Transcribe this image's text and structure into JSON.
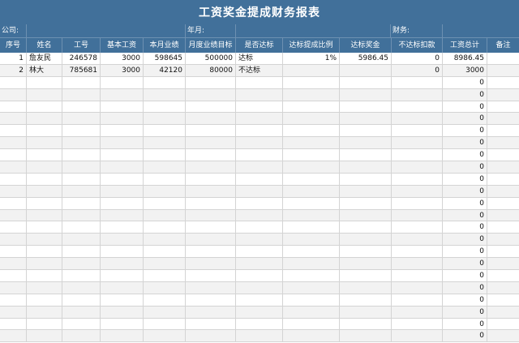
{
  "title": "工资奖金提成财务报表",
  "info": {
    "company_label": "公司:",
    "month_label": "年月:",
    "finance_label": "财务:"
  },
  "headers": [
    "序号",
    "姓名",
    "工号",
    "基本工资",
    "本月业绩",
    "月度业绩目标",
    "是否达标",
    "达标提成比例",
    "达标奖金",
    "不达标扣款",
    "工资总计",
    "备注"
  ],
  "records": [
    {
      "seq": "1",
      "name": "詹友民",
      "id": "246578",
      "base": "3000",
      "perf": "598645",
      "target": "500000",
      "met": "达标",
      "ratio": "1%",
      "bonus": "5986.45",
      "deduct": "0",
      "total": "8986.45",
      "note": ""
    },
    {
      "seq": "2",
      "name": "林大",
      "id": "785681",
      "base": "3000",
      "perf": "42120",
      "target": "80000",
      "met": "不达标",
      "ratio": "",
      "bonus": "",
      "deduct": "0",
      "total": "3000",
      "note": ""
    }
  ],
  "empty_total": "0",
  "empty_row_count": 22
}
